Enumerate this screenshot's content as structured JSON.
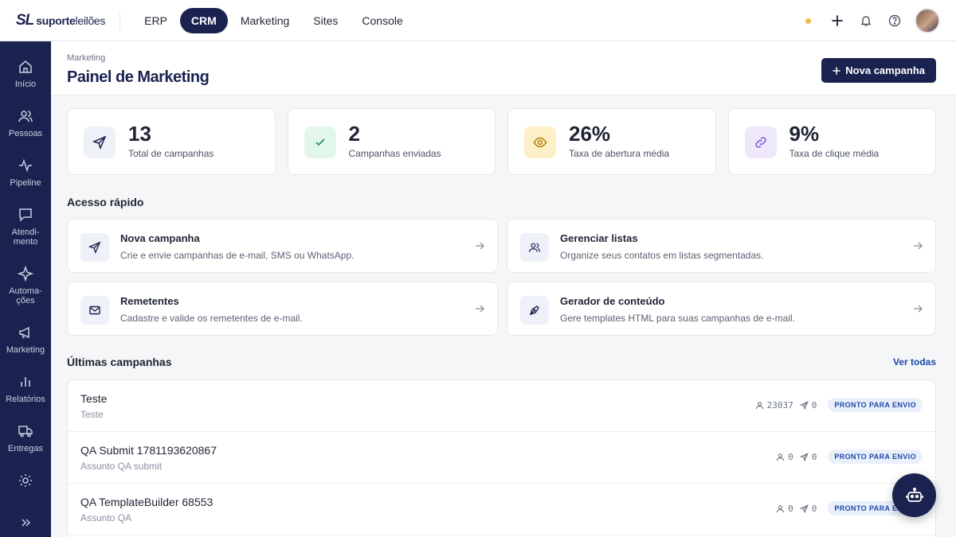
{
  "brand": {
    "mark": "SL",
    "name_bold": "suporte",
    "name_light": "leilões"
  },
  "topnav": [
    {
      "label": "ERP",
      "active": false
    },
    {
      "label": "CRM",
      "active": true
    },
    {
      "label": "Marketing",
      "active": false
    },
    {
      "label": "Sites",
      "active": false
    },
    {
      "label": "Console",
      "active": false
    }
  ],
  "sidebar": {
    "items": [
      {
        "label": "Início",
        "icon": "home-icon"
      },
      {
        "label": "Pessoas",
        "icon": "users-icon"
      },
      {
        "label": "Pipeline",
        "icon": "pulse-icon"
      },
      {
        "label": "Atendi-\nmento",
        "icon": "chat-icon"
      },
      {
        "label": "Automa-\nções",
        "icon": "sparkle-icon"
      },
      {
        "label": "Marketing",
        "icon": "megaphone-icon"
      },
      {
        "label": "Relatórios",
        "icon": "bar-chart-icon"
      },
      {
        "label": "Entregas",
        "icon": "truck-icon"
      },
      {
        "label": "",
        "icon": "gear-icon"
      }
    ]
  },
  "header": {
    "breadcrumb": "Marketing",
    "title": "Painel de Marketing",
    "new_campaign_label": "Nova campanha"
  },
  "stats": [
    {
      "value": "13",
      "label": "Total de campanhas",
      "icon": "send-icon",
      "bg": "#eef1f8",
      "fg": "#1a2350"
    },
    {
      "value": "2",
      "label": "Campanhas enviadas",
      "icon": "check-icon",
      "bg": "#e3f6ea",
      "fg": "#1f8a4c"
    },
    {
      "value": "26%",
      "label": "Taxa de abertura média",
      "icon": "eye-icon",
      "bg": "#fdf0c9",
      "fg": "#b27a00"
    },
    {
      "value": "9%",
      "label": "Taxa de clique média",
      "icon": "link-icon",
      "bg": "#efe8fb",
      "fg": "#7b4fd6"
    }
  ],
  "quick_access": {
    "title": "Acesso rápido",
    "items": [
      {
        "title": "Nova campanha",
        "desc": "Crie e envie campanhas de e-mail, SMS ou WhatsApp.",
        "icon": "send-icon"
      },
      {
        "title": "Gerenciar listas",
        "desc": "Organize seus contatos em listas segmentadas.",
        "icon": "users-icon"
      },
      {
        "title": "Remetentes",
        "desc": "Cadastre e valide os remetentes de e-mail.",
        "icon": "mail-icon"
      },
      {
        "title": "Gerador de conteúdo",
        "desc": "Gere templates HTML para suas campanhas de e-mail.",
        "icon": "pen-icon"
      }
    ]
  },
  "campaigns": {
    "title": "Últimas campanhas",
    "see_all": "Ver todas",
    "rows": [
      {
        "name": "Teste",
        "subject": "Teste",
        "recipients": "23037",
        "sent": "0",
        "status": "PRONTO PARA ENVIO"
      },
      {
        "name": "QA Submit 1781193620867",
        "subject": "Assunto QA submit",
        "recipients": "0",
        "sent": "0",
        "status": "PRONTO PARA ENVIO"
      },
      {
        "name": "QA TemplateBuilder 68553",
        "subject": "Assunto QA",
        "recipients": "0",
        "sent": "0",
        "status": "PRONTO PARA ENVIO"
      }
    ]
  },
  "colors": {
    "brand": "#1a2350",
    "accent_link": "#1d4aa8",
    "status_dot": "#f2b84b"
  }
}
